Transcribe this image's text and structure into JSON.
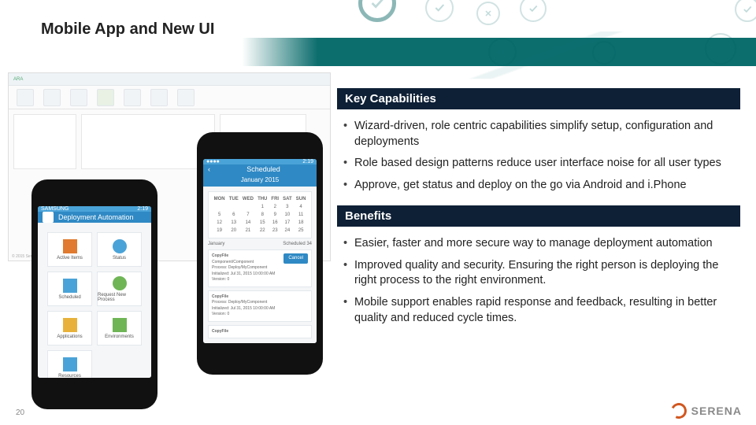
{
  "title": "Mobile App and New UI",
  "page_number": "20",
  "brand": "SERENA",
  "sections": {
    "capabilities": {
      "heading": "Key Capabilities",
      "items": [
        "Wizard-driven, role centric capabilities simplify setup, configuration and deployments",
        "Role based design patterns reduce user interface noise for all user types",
        "Approve, get status and deploy on the go via Android and i.Phone"
      ]
    },
    "benefits": {
      "heading": "Benefits",
      "items": [
        "Easier, faster and more secure way to manage deployment automation",
        "Improved quality and security. Ensuring the right person is deploying the right process to the right environment.",
        "Mobile support enables rapid response and feedback, resulting in better quality and reduced cycle times."
      ]
    }
  },
  "mock": {
    "browser_title": "ARA",
    "browser_footer": "© 2015 Serena Software, Inc.",
    "phone1": {
      "header": "Deployment Automation",
      "tiles": [
        "Active Items",
        "Status",
        "Scheduled",
        "Request New Process",
        "Applications",
        "Environments",
        "Resources",
        ""
      ]
    },
    "phone2": {
      "header": "Scheduled",
      "month": "January 2015",
      "days": [
        "MON",
        "TUE",
        "WED",
        "THU",
        "FRI",
        "SAT",
        "SUN"
      ],
      "section_label": "January",
      "section_count": "Scheduled 34",
      "card_title": "CopyFile",
      "card_line1": "Component/Component",
      "card_line2": "Process: Deploy/MyComponent",
      "card_line3": "Initialized: Jul 31, 2015 10:00:00 AM",
      "card_line4": "Version: 0",
      "cancel": "Cancel"
    },
    "time": "2:19"
  },
  "icons": {
    "check": "check-icon",
    "cross": "cross-icon"
  }
}
